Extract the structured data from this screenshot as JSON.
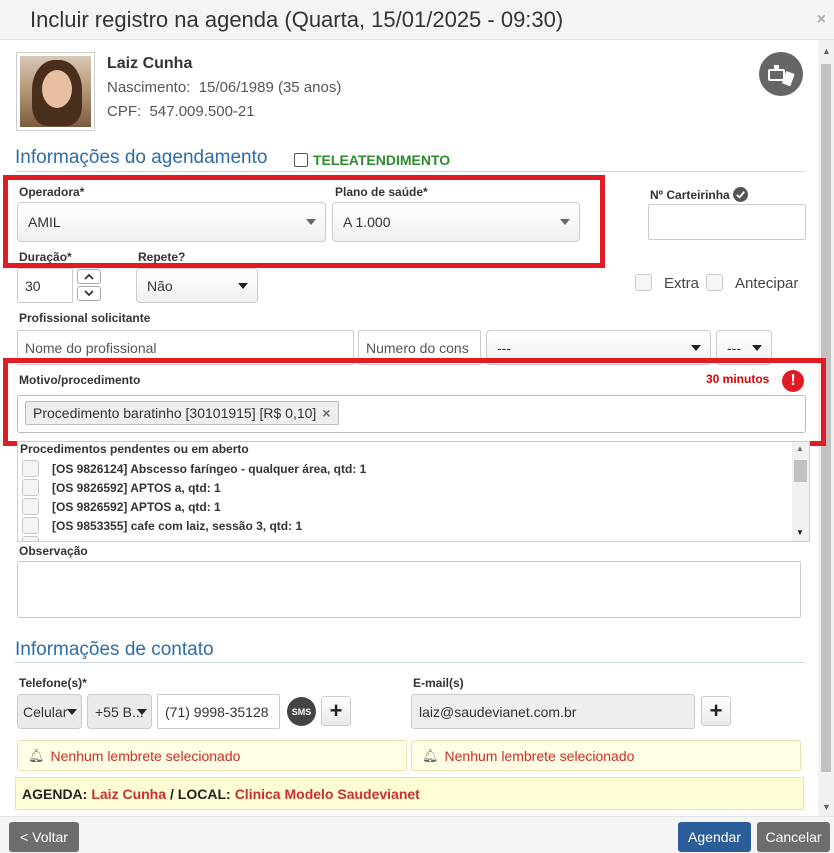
{
  "window": {
    "title": "Incluir registro na agenda (Quarta, 15/01/2025 - 09:30)",
    "close_glyph": "×"
  },
  "patient": {
    "name": "Laiz Cunha",
    "birth_label": "Nascimento:",
    "birth_value": "15/06/1989 (35 anos)",
    "cpf_label": "CPF:",
    "cpf_value": "547.009.500-21"
  },
  "icons": {
    "telehealth": "telehealth-icon",
    "verified": "check-circle-icon",
    "alert": "exclamation-icon",
    "bell": "bell-icon",
    "sms": "sms-icon",
    "add": "plus-icon"
  },
  "scheduling": {
    "section_title": "Informações do agendamento",
    "telehealth_label": "TELEATENDIMENTO",
    "operadora_label": "Operadora*",
    "operadora_value": "AMIL",
    "plano_label": "Plano de saúde*",
    "plano_value": "A 1.000",
    "carteirinha_label": "Nº Carteirinha",
    "carteirinha_value": "",
    "duracao_label": "Duração*",
    "duracao_value": "30",
    "repete_label": "Repete?",
    "repete_value": "Não",
    "extra_label": "Extra",
    "antecipar_label": "Antecipar",
    "profissional_label": "Profissional solicitante",
    "profissional_placeholder": "Nome do profissional",
    "conselho_placeholder": "Numero do cons",
    "conselho_tipo_value": "---",
    "conselho_uf_value": "---",
    "motivo_label": "Motivo/procedimento",
    "motivo_duration": "30 minutos",
    "motivo_token": "Procedimento baratinho [30101915] [R$ 0,10]",
    "motivo_token_remove": "×",
    "pending_label": "Procedimentos pendentes ou em aberto",
    "pending_items": [
      "[OS 9826124] Abscesso faríngeo - qualquer área, qtd: 1",
      "[OS 9826592] APTOS a, qtd: 1",
      "[OS 9826592] APTOS a, qtd: 1",
      "[OS 9853355] cafe com laiz, sessão 3, qtd: 1"
    ],
    "observacao_label": "Observação",
    "highlight_color": "#e01b24"
  },
  "contact": {
    "section_title": "Informações de contato",
    "phones_label": "Telefone(s)*",
    "phone_type": "Celular",
    "phone_country": "+55 B...",
    "phone_number": "(71) 9998-35128",
    "sms_label": "SMS",
    "email_label": "E-mail(s)",
    "email_value": "laiz@saudevianet.com.br",
    "reminder_phone": "Nenhum lembrete selecionado",
    "reminder_email": "Nenhum lembrete selecionado"
  },
  "summary": {
    "agenda_label": "AGENDA:",
    "agenda_value": "Laiz Cunha",
    "separator": "/",
    "local_label": "LOCAL:",
    "local_value": "Clinica Modelo Saudevianet"
  },
  "footer": {
    "back_label": "< Voltar",
    "submit_label": "Agendar",
    "cancel_label": "Cancelar",
    "submit_color": "#2b5d99",
    "cancel_color": "#6d6d6d"
  }
}
